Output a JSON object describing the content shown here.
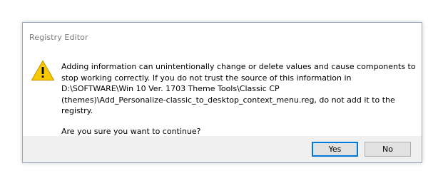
{
  "window": {
    "title": "Registry Editor"
  },
  "dialog": {
    "icon": "warning-icon",
    "message_lines": [
      "Adding information can unintentionally change or delete values and cause components to",
      "stop working correctly. If you do not trust the source of this information in",
      "D:\\SOFTWARE\\Win 10 Ver. 1703 Theme Tools\\Classic CP",
      "(themes)\\Add_Personalize-classic_to_desktop_context_menu.reg, do not add it to the registry."
    ],
    "question": "Are you sure you want to continue?",
    "yes_label": "Yes",
    "no_label": "No"
  },
  "colors": {
    "warning_fill": "#f7c900",
    "default_button_border": "#0078d7",
    "footer_bg": "#f0f0f0"
  }
}
